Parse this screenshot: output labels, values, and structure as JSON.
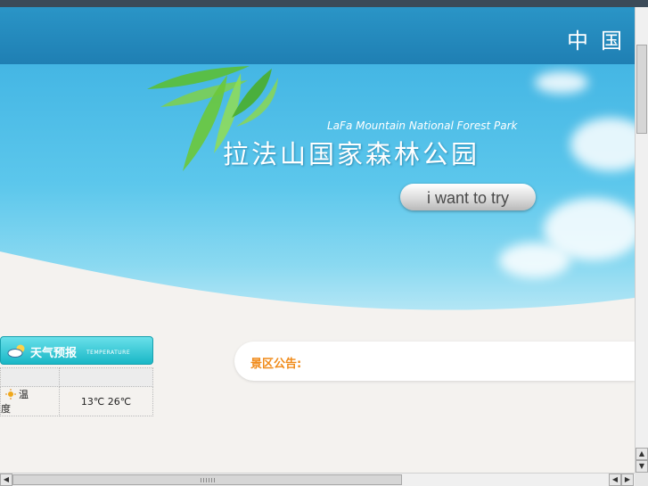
{
  "header": {
    "site_name_partial": "中国"
  },
  "banner": {
    "park_name_en": "LaFa Mountain National Forest Park",
    "park_name_cn": "拉法山国家森林公园",
    "try_button_label": "i want to try"
  },
  "weather": {
    "title": "天气预报",
    "subtitle": "TEMPERATURE",
    "row_label": "温 度",
    "row_value": "13℃ 26℃"
  },
  "notice": {
    "label": "景区公告:"
  },
  "colors": {
    "header_blue": "#1f7fb3",
    "weather_cyan": "#19b7c6",
    "notice_orange": "#f08b1a"
  },
  "icons": {
    "weather_header": "cloud-sun-icon",
    "temperature_row": "sun-icon"
  }
}
